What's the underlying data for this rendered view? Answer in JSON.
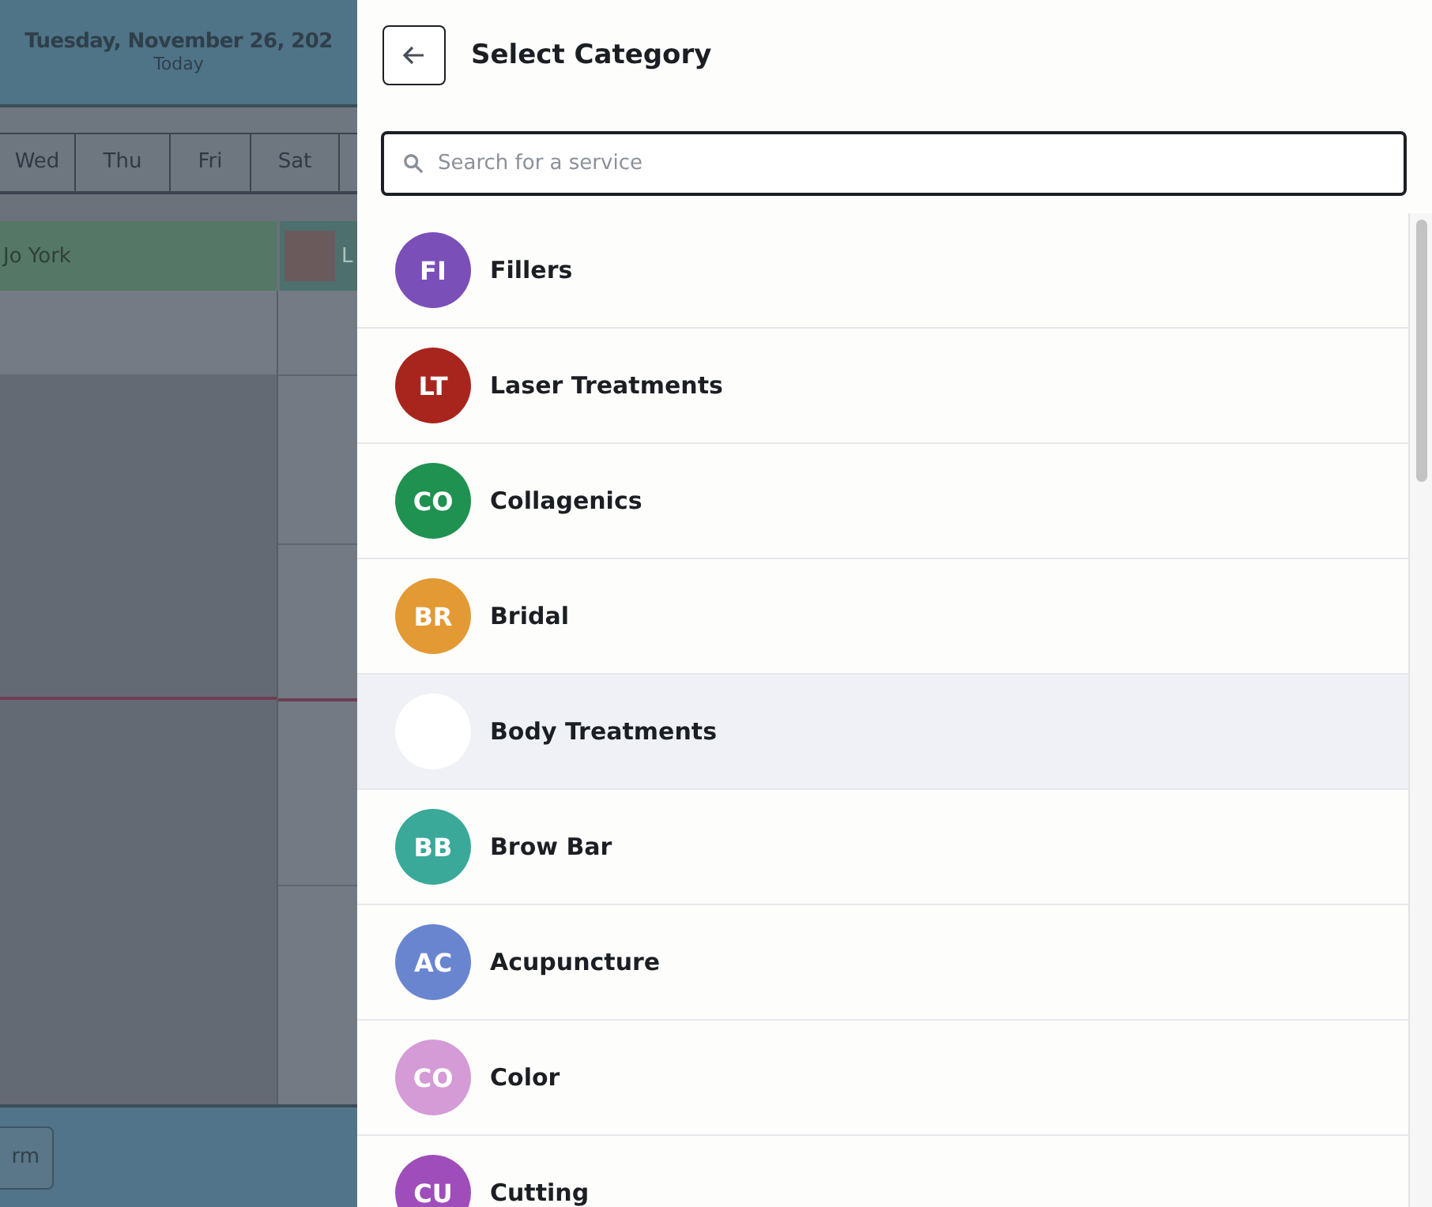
{
  "calendar": {
    "date_title": "Tuesday, November 26, 202",
    "date_subtitle": "Today",
    "day_tabs": [
      {
        "label": "Wed"
      },
      {
        "label": "Thu"
      },
      {
        "label": "Fri"
      },
      {
        "label": "Sat"
      }
    ],
    "staff": [
      {
        "name": "Jo York"
      },
      {
        "name": "L"
      }
    ],
    "footer_button": "rm"
  },
  "panel": {
    "title": "Select Category",
    "search": {
      "placeholder": "Search for a service"
    },
    "categories": [
      {
        "initials": "FI",
        "name": "Fillers",
        "color": "#7b4fb8",
        "hovered": false
      },
      {
        "initials": "LT",
        "name": "Laser Treatments",
        "color": "#a8251d",
        "hovered": false
      },
      {
        "initials": "CO",
        "name": "Collagenics",
        "color": "#1f9150",
        "hovered": false
      },
      {
        "initials": "BR",
        "name": "Bridal",
        "color": "#e39a35",
        "hovered": false
      },
      {
        "name": "Body Treatments",
        "color": "#ffffff",
        "hovered": true
      },
      {
        "initials": "BB",
        "name": "Brow Bar",
        "color": "#3aa99a",
        "hovered": false
      },
      {
        "initials": "AC",
        "name": "Acupuncture",
        "color": "#6a85d0",
        "hovered": false
      },
      {
        "initials": "CO",
        "name": "Color",
        "color": "#d59bd6",
        "hovered": false
      },
      {
        "initials": "CU",
        "name": "Cutting",
        "color": "#9e4dba",
        "hovered": false
      }
    ]
  }
}
